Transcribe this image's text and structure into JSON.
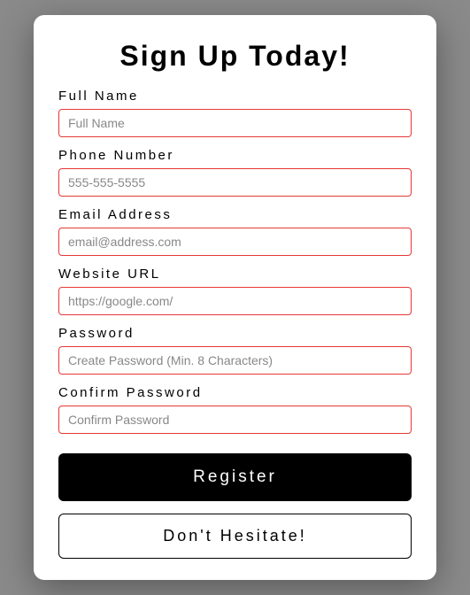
{
  "title": "Sign Up Today!",
  "fields": {
    "fullName": {
      "label": "Full Name",
      "placeholder": "Full Name"
    },
    "phone": {
      "label": "Phone Number",
      "placeholder": "555-555-5555"
    },
    "email": {
      "label": "Email Address",
      "placeholder": "email@address.com"
    },
    "website": {
      "label": "Website URL",
      "placeholder": "https://google.com/"
    },
    "password": {
      "label": "Password",
      "placeholder": "Create Password (Min. 8 Characters)"
    },
    "confirmPassword": {
      "label": "Confirm Password",
      "placeholder": "Confirm Password"
    }
  },
  "buttons": {
    "register": "Register",
    "secondary": "Don't Hesitate!"
  }
}
